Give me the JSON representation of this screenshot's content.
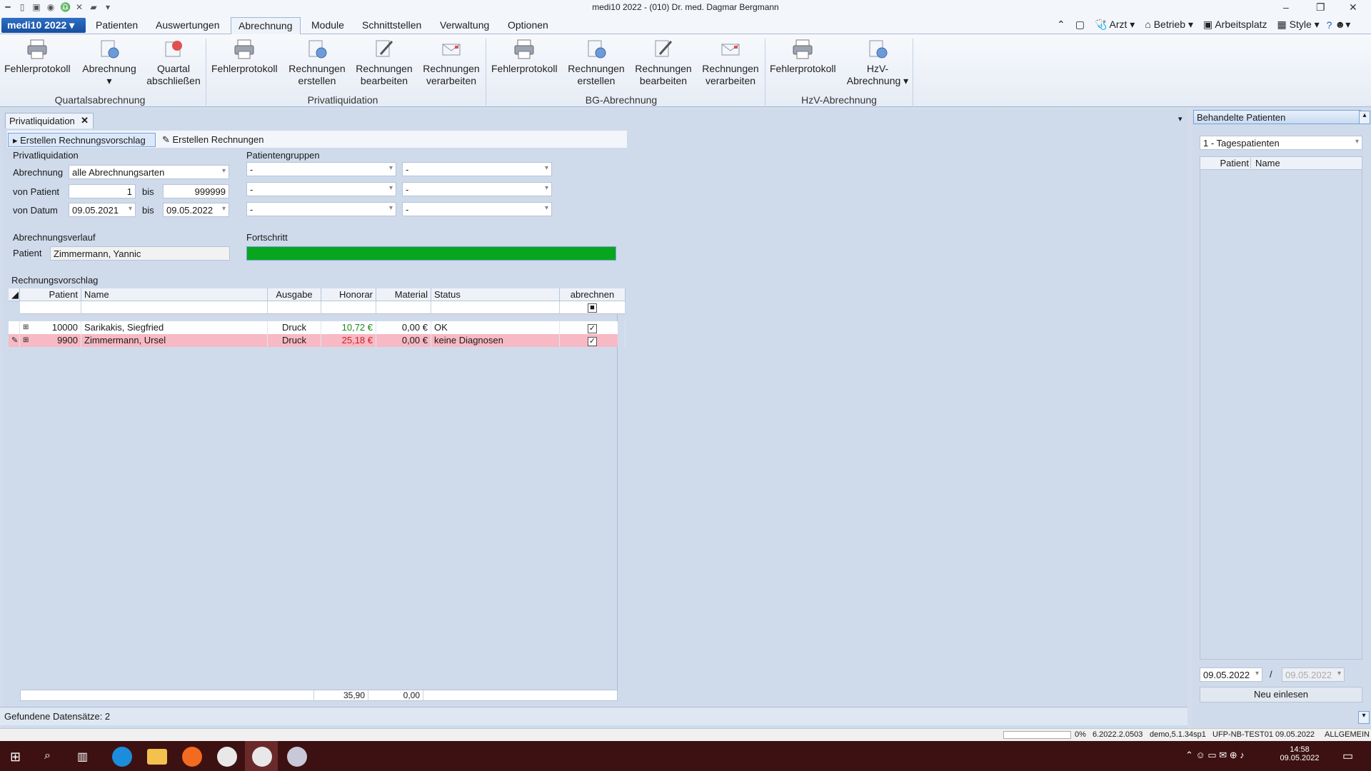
{
  "window": {
    "title": "medi10 2022 - (010) Dr. med. Dagmar Bergmann"
  },
  "app_button": "medi10 2022",
  "menu": [
    "Patienten",
    "Auswertungen",
    "Abrechnung",
    "Module",
    "Schnittstellen",
    "Verwaltung",
    "Optionen"
  ],
  "right_menu": {
    "arzt": "Arzt",
    "betrieb": "Betrieb",
    "arbeitsplatz": "Arbeitsplatz",
    "style": "Style"
  },
  "ribbon": {
    "buttons": [
      "Fehlerprotokoll",
      "Abrechnung",
      "Quartal abschließen",
      "Fehlerprotokoll",
      "Rechnungen erstellen",
      "Rechnungen bearbeiten",
      "Rechnungen verarbeiten",
      "Fehlerprotokoll",
      "Rechnungen erstellen",
      "Rechnungen bearbeiten",
      "Rechnungen verarbeiten",
      "Fehlerprotokoll",
      "HzV-Abrechnung"
    ],
    "groups": [
      "Quartalsabrechnung",
      "Privatliquidation",
      "BG-Abrechnung",
      "HzV-Abrechnung"
    ]
  },
  "doc_tab": "Privatliquidation",
  "subtabs": [
    "Erstellen Rechnungsvorschlag",
    "Erstellen Rechnungen"
  ],
  "form": {
    "section": "Privatliquidation",
    "abrechnung_label": "Abrechnung",
    "abrechnung_value": "alle Abrechnungsarten",
    "von_patient_label": "von Patient",
    "von_patient": "1",
    "bis_label": "bis",
    "bis_patient": "999999",
    "von_datum_label": "von Datum",
    "von_datum": "09.05.2021",
    "bis_datum": "09.05.2022",
    "patientengruppen": "Patientengruppen",
    "dash": "-",
    "verlauf": "Abrechnungsverlauf",
    "patient_label": "Patient",
    "patient_value": "Zimmermann, Yannic",
    "fortschritt": "Fortschritt",
    "progress": 1.0
  },
  "grid": {
    "title": "Rechnungsvorschlag",
    "headers": [
      "Patient",
      "Name",
      "Ausgabe",
      "Honorar",
      "Material",
      "Status",
      "abrechnen"
    ],
    "rows": [
      {
        "patient": "10000",
        "name": "Sarikakis, Siegfried",
        "ausgabe": "Druck",
        "honorar": "10,72 €",
        "material": "0,00 €",
        "status": "OK"
      },
      {
        "patient": "9900",
        "name": "Zimmermann, Ursel",
        "ausgabe": "Druck",
        "honorar": "25,18 €",
        "material": "0,00 €",
        "status": "keine Diagnosen"
      }
    ],
    "total_honorar": "35,90",
    "total_material": "0,00"
  },
  "status": "Gefundene Datensätze: 2",
  "right_panel": {
    "title": "Behandelte Patienten",
    "filter": "1 - Tagespatienten",
    "col_patient": "Patient",
    "col_name": "Name",
    "date_from": "09.05.2022",
    "slash": "/",
    "date_to": "09.05.2022",
    "button": "Neu einlesen"
  },
  "bottom": {
    "pct": "0%",
    "version": "6.2022.2.0503",
    "demo": "demo,5.1.34sp1",
    "host": "UFP-NB-TEST01",
    "date": "09.05.2022",
    "mode": "ALLGEMEIN"
  },
  "clock": {
    "time": "14:58",
    "date": "09.05.2022"
  },
  "colors": {
    "progress": "#07a61e",
    "error_row": "#f7b9c4",
    "accent": "#1f5db5"
  }
}
